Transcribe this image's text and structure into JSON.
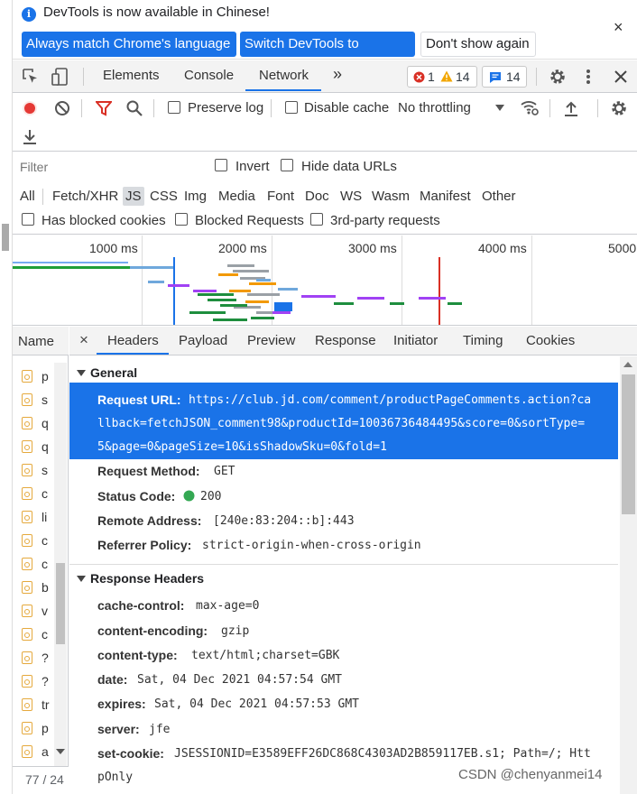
{
  "infobar": {
    "message": "DevTools is now available in Chinese!",
    "btn_match": "Always match Chrome's language",
    "btn_switch": "Switch DevTools to Chinese",
    "btn_dont_show": "Don't show again",
    "close": "×"
  },
  "tabs": {
    "elements": "Elements",
    "console": "Console",
    "network": "Network",
    "more": "»",
    "errors": "1",
    "warnings": "14",
    "messages": "14"
  },
  "network_toolbar": {
    "preserve_log": "Preserve log",
    "disable_cache": "Disable cache",
    "throttling": "No throttling"
  },
  "filter": {
    "placeholder": "Filter",
    "invert": "Invert",
    "hide_data_urls": "Hide data URLs",
    "types": [
      "All",
      "Fetch/XHR",
      "JS",
      "CSS",
      "Img",
      "Media",
      "Font",
      "Doc",
      "WS",
      "Wasm",
      "Manifest",
      "Other"
    ],
    "has_blocked_cookies": "Has blocked cookies",
    "blocked_requests": "Blocked Requests",
    "third_party": "3rd-party requests"
  },
  "overview": {
    "ticks": [
      "1000 ms",
      "2000 ms",
      "3000 ms",
      "4000 ms",
      "5000"
    ]
  },
  "request_list": {
    "header": "Name",
    "names": [
      "p",
      "s",
      "q",
      "q",
      "s",
      "c",
      "li",
      "c",
      "c",
      "b",
      "v",
      "c",
      "?",
      "?",
      "tr",
      "p",
      "a"
    ],
    "status": "77 / 24"
  },
  "detail_tabs": {
    "close": "×",
    "headers": "Headers",
    "payload": "Payload",
    "preview": "Preview",
    "response": "Response",
    "initiator": "Initiator",
    "timing": "Timing",
    "cookies": "Cookies"
  },
  "general": {
    "title": "General",
    "request_url_key": "Request URL:",
    "request_url_line1": "https://club.jd.com/comment/productPageComments.action?ca",
    "request_url_line2": "llback=fetchJSON_comment98&productId=10036736484495&score=0&sortType=",
    "request_url_line3": "5&page=0&pageSize=10&isShadowSku=0&fold=1",
    "method_key": "Request Method:",
    "method_val": "GET",
    "status_key": "Status Code:",
    "status_val": "200",
    "remote_key": "Remote Address:",
    "remote_val": "[240e:83:204::b]:443",
    "referrer_key": "Referrer Policy:",
    "referrer_val": "strict-origin-when-cross-origin"
  },
  "response_headers": {
    "title": "Response Headers",
    "items": [
      {
        "key": "cache-control:",
        "val": "max-age=0"
      },
      {
        "key": "content-encoding:",
        "val": "gzip"
      },
      {
        "key": "content-type:",
        "val": "text/html;charset=GBK"
      },
      {
        "key": "date:",
        "val": "Sat, 04 Dec 2021 04:57:54 GMT"
      },
      {
        "key": "expires:",
        "val": "Sat, 04 Dec 2021 04:57:53 GMT"
      },
      {
        "key": "server:",
        "val": "jfe"
      },
      {
        "key": "set-cookie:",
        "val": "JSESSIONID=E3589EFF26DC868C4303AD2B859117EB.s1; Path=/; Htt"
      }
    ],
    "cont": "pOnly"
  },
  "watermark": "CSDN @chenyanmei14",
  "colors": {
    "accent": "#1a73e8",
    "record": "#e53935",
    "filter_icon": "#d93025",
    "status_ok": "#34a853"
  }
}
